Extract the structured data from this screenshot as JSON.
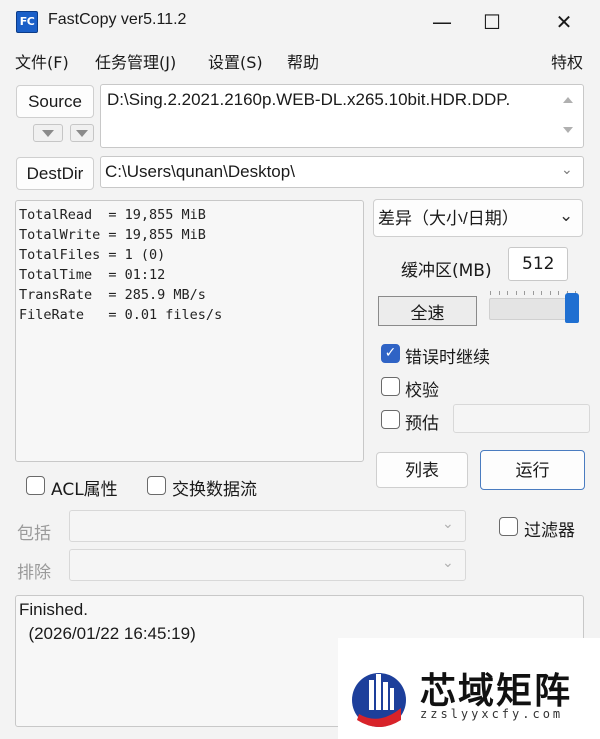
{
  "window": {
    "title": "FastCopy ver5.11.2",
    "icon_text": "FC",
    "controls": {
      "minimize": "—",
      "maximize": "☐",
      "close": "✕"
    }
  },
  "menu": {
    "file": "文件(F)",
    "jobs": "任务管理(J)",
    "settings": "设置(S)",
    "help": "帮助",
    "privilege": "特权"
  },
  "source": {
    "button_label": "Source",
    "path": "D:\\Sing.2.2021.2160p.WEB-DL.x265.10bit.HDR.DDP."
  },
  "dest": {
    "button_label": "DestDir",
    "path": "C:\\Users\\qunan\\Desktop\\"
  },
  "stats": {
    "line1": "TotalRead  = 19,855 MiB",
    "line2": "TotalWrite = 19,855 MiB",
    "line3": "TotalFiles = 1 (0)",
    "line4": "TotalTime  = 01:12",
    "line5": "TransRate  = 285.9 MB/s",
    "line6": "FileRate   = 0.01 files/s"
  },
  "mode": {
    "selected": "差异（大小/日期）"
  },
  "buffer": {
    "label": "缓冲区(MB)",
    "value": "512"
  },
  "speed": {
    "label": "全速",
    "level": 1.0
  },
  "options": {
    "continue_on_error": {
      "label": "错误时继续",
      "checked": true
    },
    "verify": {
      "label": "校验",
      "checked": false
    },
    "estimate": {
      "label": "预估",
      "checked": false
    }
  },
  "buttons": {
    "list": "列表",
    "run": "运行"
  },
  "extra": {
    "acl": {
      "label": "ACL属性",
      "checked": false
    },
    "streams": {
      "label": "交换数据流",
      "checked": false
    },
    "filter": {
      "label": "过滤器",
      "checked": false
    }
  },
  "filters": {
    "include_label": "包括",
    "exclude_label": "排除"
  },
  "status": {
    "line1": "Finished.",
    "line2": "  (2026/01/22 16:45:19)"
  },
  "watermark": {
    "name": "芯域矩阵",
    "url": "zzslyyxcfy.com"
  },
  "colors": {
    "accent": "#2f63c5",
    "slider": "#1f6fd1"
  }
}
